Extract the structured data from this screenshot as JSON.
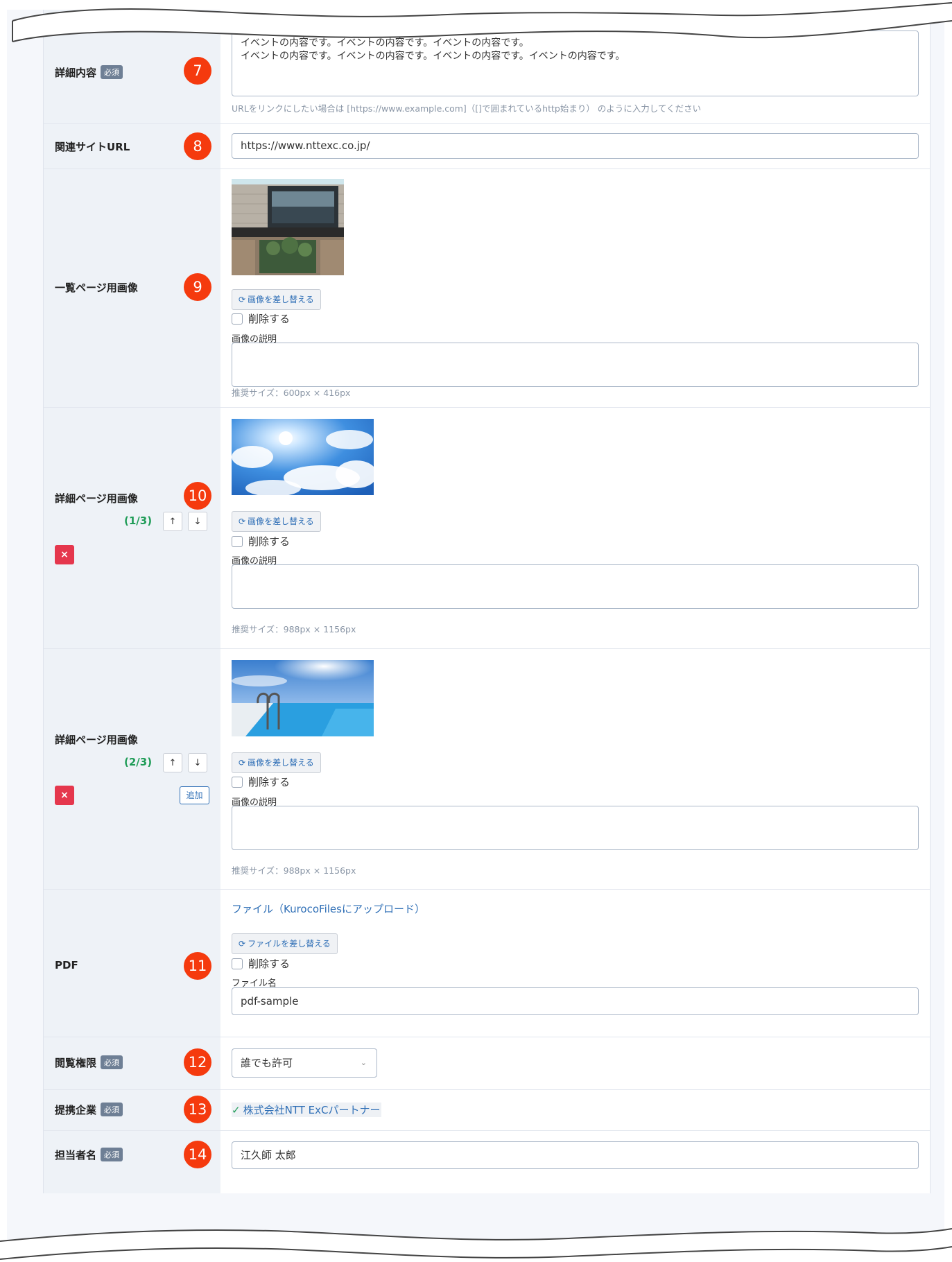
{
  "rows": {
    "detail": {
      "label": "詳細内容",
      "required": "必須",
      "number": "7",
      "text_line1": "イベントの内容です。イベントの内容です。イベントの内容です。",
      "text_line2": "イベントの内容です。イベントの内容です。イベントの内容です。イベントの内容です。",
      "hint": "URLをリンクにしたい場合は [https://www.example.com]（[]で囲まれているhttp始まり） のように入力してください"
    },
    "related_url": {
      "label": "関連サイトURL",
      "number": "8",
      "value": "https://www.nttexc.co.jp/"
    },
    "list_image": {
      "label": "一覧ページ用画像",
      "number": "9",
      "replace_button": "画像を差し替える",
      "delete_label": "削除する",
      "desc_label": "画像の説明",
      "size_hint": "推奨サイズ：600px × 416px"
    },
    "detail_image_1": {
      "label": "詳細ページ用画像",
      "number": "10",
      "order": "(1/3)",
      "up": "↑",
      "down": "↓",
      "delete_icon": "×",
      "replace_button": "画像を差し替える",
      "delete_label": "削除する",
      "desc_label": "画像の説明",
      "size_hint": "推奨サイズ：988px × 1156px"
    },
    "detail_image_2": {
      "label": "詳細ページ用画像",
      "order": "(2/3)",
      "up": "↑",
      "down": "↓",
      "delete_icon": "×",
      "add_button": "追加",
      "replace_button": "画像を差し替える",
      "delete_label": "削除する",
      "desc_label": "画像の説明",
      "size_hint": "推奨サイズ：988px × 1156px"
    },
    "pdf": {
      "label": "PDF",
      "number": "11",
      "file_link": "ファイル（KurocoFilesにアップロード）",
      "replace_button": "ファイルを差し替える",
      "delete_label": "削除する",
      "filename_label": "ファイル名",
      "filename_value": "pdf-sample"
    },
    "permission": {
      "label": "閲覧権限",
      "required": "必須",
      "number": "12",
      "selected": "誰でも許可"
    },
    "partner": {
      "label": "提携企業",
      "required": "必須",
      "number": "13",
      "value": "株式会社NTT ExCパートナー"
    },
    "person": {
      "label": "担当者名",
      "required": "必須",
      "number": "14",
      "value": "江久師 太郎"
    }
  },
  "icons": {
    "refresh": "refresh-icon",
    "check_circle": "check-circle-icon",
    "chevron": "chevron-down-icon"
  },
  "colors": {
    "number_badge": "#f53a0e",
    "link": "#2f6fb6",
    "order_text": "#1f9c57",
    "delete_button": "#e5374d",
    "label_bg": "#eef2f7"
  }
}
